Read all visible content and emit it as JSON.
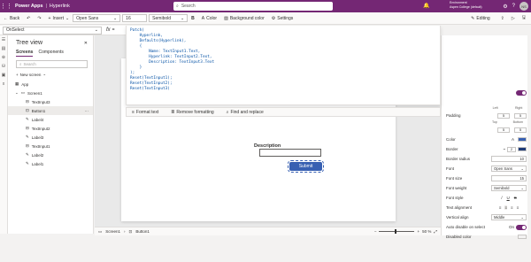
{
  "titlebar": {
    "waffle_icon": "waffle-icon",
    "app_name": "Power Apps",
    "separator": "|",
    "doc_name": "Hyperlink",
    "search_placeholder": "Search",
    "env_line1": "Environment",
    "env_line2": "Aspen College (default)",
    "avatar": "NS"
  },
  "cmdbar": {
    "back": "Back",
    "undo": "↶",
    "redo": "↷",
    "insert": "Insert",
    "font": "Open Sans",
    "size": "16",
    "weight": "Semibold",
    "color": "Color",
    "background": "Background color",
    "settings": "Settings",
    "editing": "Editing"
  },
  "formulabar": {
    "property": "OnSelect",
    "fx": "fx",
    "eq": "="
  },
  "formula_lines": [
    "Patch(",
    "    Hyperlink,",
    "    Defaults(Hyperlink),",
    "    {",
    "        Name: TextInput1.Text,",
    "        Hyperlink: TextInput2.Text,",
    "        Description: TextInput3.Text",
    "    }",
    ");",
    "Reset(TextInput1);",
    "Reset(TextInput2);",
    "Reset(TextInput3)"
  ],
  "formula_tools": {
    "format": "Format text",
    "remove": "Remove formatting",
    "find": "Find and replace"
  },
  "tree": {
    "title": "Tree view",
    "tab_screens": "Screens",
    "tab_components": "Components",
    "search_placeholder": "Search",
    "new_screen": "New screen",
    "items": [
      {
        "label": "App",
        "child": false,
        "selected": false
      },
      {
        "label": "Screen1",
        "child": false,
        "selected": false
      },
      {
        "label": "TextInput3",
        "child": true,
        "selected": false
      },
      {
        "label": "Button1",
        "child": true,
        "selected": true
      },
      {
        "label": "Label4",
        "child": true,
        "selected": false
      },
      {
        "label": "TextInput2",
        "child": true,
        "selected": false
      },
      {
        "label": "Label3",
        "child": true,
        "selected": false
      },
      {
        "label": "TextInput1",
        "child": true,
        "selected": false
      },
      {
        "label": "Label2",
        "child": true,
        "selected": false
      },
      {
        "label": "Label1",
        "child": true,
        "selected": false
      }
    ]
  },
  "canvas": {
    "description_label": "Description",
    "submit_label": "Submit"
  },
  "statusbar": {
    "screen": "Screen1",
    "control": "Button1",
    "zoom_minus": "−",
    "zoom_plus": "+",
    "zoom_value": "50 %"
  },
  "props": {
    "padding_label": "Padding",
    "padding_top": "5",
    "padding_bottom": "5",
    "padding_left": "5",
    "padding_right": "5",
    "border_label": "Border",
    "border_radius_label": "Border radius",
    "border_radius": "10",
    "color_label": "Color",
    "font_label": "Font",
    "font_value": "Open Sans",
    "font_size_label": "Font size",
    "font_size_value": "15",
    "font_weight_label": "Font weight",
    "font_weight_value": "Semibold",
    "font_style_label": "Font style",
    "text_alignment_label": "Text alignment",
    "vertical_align_label": "Vertical align",
    "vertical_align_value": "Middle",
    "auto_disable_label": "Auto disable on select",
    "auto_disable_value": "On",
    "disabled_color_label": "Disabled color",
    "top": "Top",
    "bottom": "Bottom",
    "left": "Left",
    "right": "Right",
    "border_width": "2"
  }
}
